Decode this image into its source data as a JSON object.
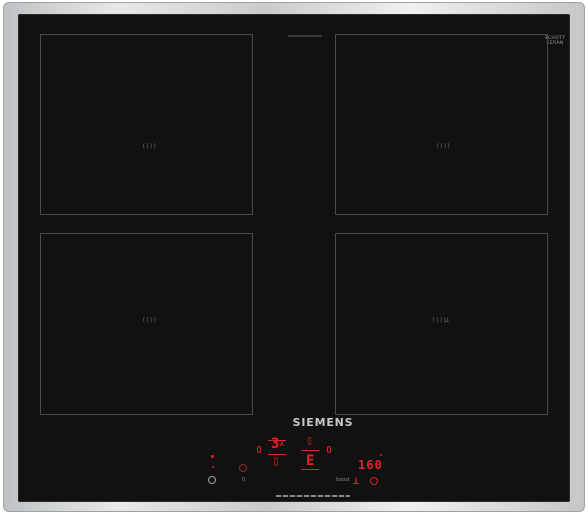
{
  "hob": {
    "top_code": "",
    "brand": "SIEMENS",
    "glass_badge": {
      "line1": "SCHOTT",
      "line2": "CERAN"
    },
    "zone_markers": [
      "(())",
      "(())",
      "(())",
      "(())"
    ],
    "zone_extra_symbol": "⊥",
    "controls": {
      "left_display": "3",
      "left_display_sub": "A",
      "center_display": "E",
      "timer_display": "160",
      "slider_min": "0",
      "slider_max": "boost"
    }
  }
}
